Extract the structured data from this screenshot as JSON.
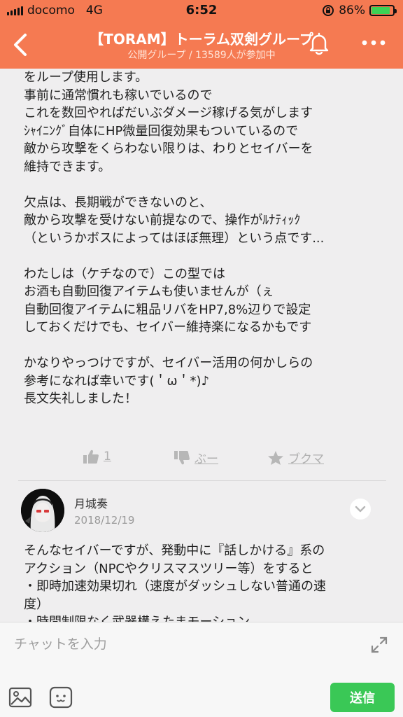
{
  "status_bar": {
    "carrier": "docomo",
    "network": "4G",
    "time": "6:52",
    "battery": "86%",
    "battery_level": 0.86
  },
  "header": {
    "title": "【TORAM】トーラム双剣グループ",
    "subtitle": "公開グループ / 13589人が参加中"
  },
  "post": {
    "text": "をループ使用します。\n事前に通常慣れも稼いでいるので\nこれを数回やればだいぶダメージ稼げる気がします\nｼｬｲﾆﾝｸﾞ自体にHP微量回復効果もついているので\n敵から攻撃をくらわない限りは、わりとセイバーを\n維持できます。\n\n欠点は、長期戦ができないのと、\n敵から攻撃を受けない前提なので、操作がﾙﾅﾃｨｯｸ\n（というかボスによってはほぼ無理）という点です...\n\nわたしは（ケチなので）この型では\nお酒も自動回復アイテムも使いませんが（ぇ\n自動回復アイテムに粗品リバをHP7,8%辺りで設定\nしておくだけでも、セイバー維持楽になるかもです\n\nかなりやっつけですが、セイバー活用の何かしらの\n参考になれば幸いです(＇ω＇*)♪\n長文失礼しました！",
    "like_count": "1",
    "boo_label": "ぶー",
    "bookmark_label": "ブクマ"
  },
  "comment": {
    "author": "月城奏",
    "date": "2018/12/19",
    "text": "そんなセイバーですが、発動中に『話しかける』系の\nアクション（NPCやクリスマスツリー等）をすると\n・即時加速効果切れ（速度がダッシュしない普通の速\n度）\n・時間制限なく武器構えたまモーション"
  },
  "input_bar": {
    "placeholder": "チャットを入力",
    "send_label": "送信"
  },
  "colors": {
    "header_bg": "#f57a52",
    "send_bg": "#3ac856",
    "battery_fill": "#3cd255"
  }
}
